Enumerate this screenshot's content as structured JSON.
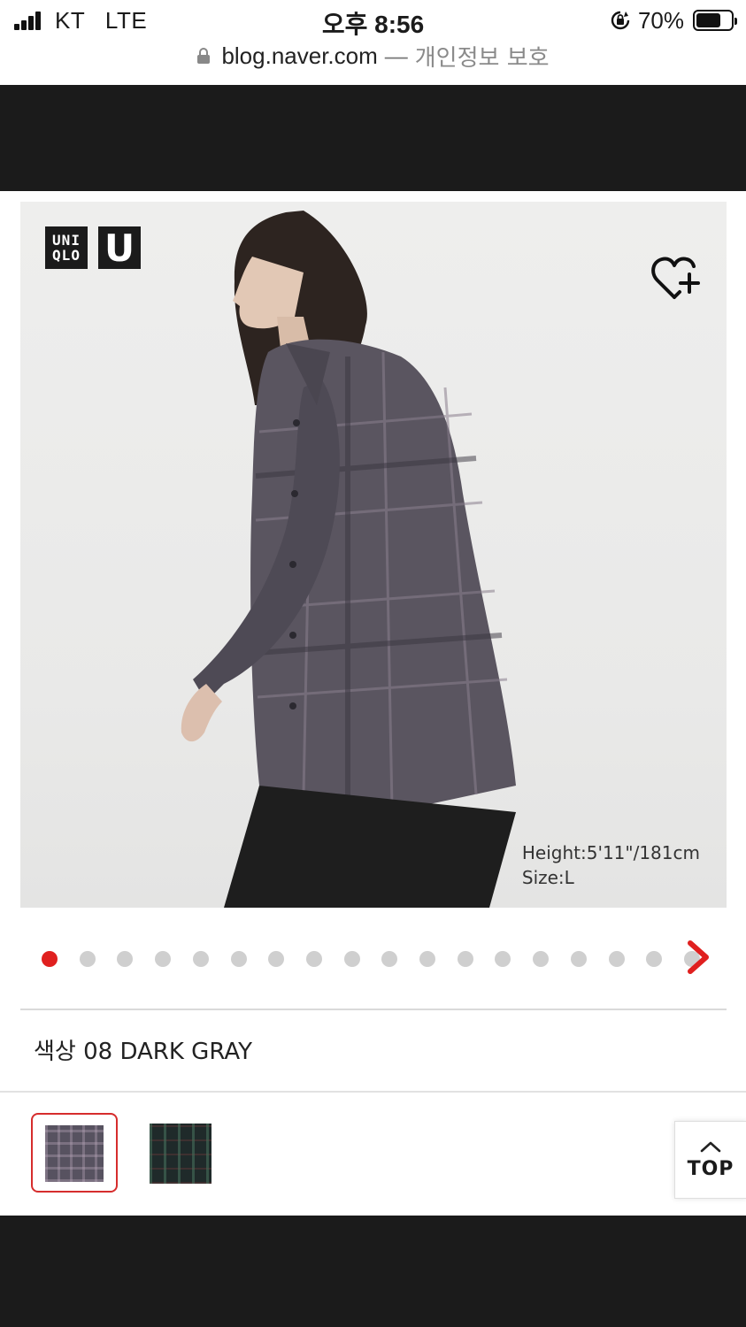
{
  "status_bar": {
    "carrier": "KT   LTE",
    "time": "오후 8:56",
    "battery_percent": "70%",
    "battery_level": 0.7
  },
  "url_bar": {
    "host": "blog.naver.com",
    "separator": "—",
    "privacy_label": "개인정보 보호"
  },
  "product": {
    "brand_logo_text": [
      "UNI",
      "QLO"
    ],
    "brand_sub_logo": "U",
    "model_height": "Height:5'11\"/181cm",
    "model_size": "Size:L",
    "color_label": "색상 08 DARK GRAY"
  },
  "carousel": {
    "total_dots": 18,
    "active_index": 0
  },
  "swatches": [
    {
      "name": "dark-gray",
      "selected": true
    },
    {
      "name": "dark-green",
      "selected": false
    }
  ],
  "top_button": {
    "label": "TOP"
  },
  "colors": {
    "accent_red": "#e0201f",
    "dark_bar": "#1b1b1b"
  }
}
